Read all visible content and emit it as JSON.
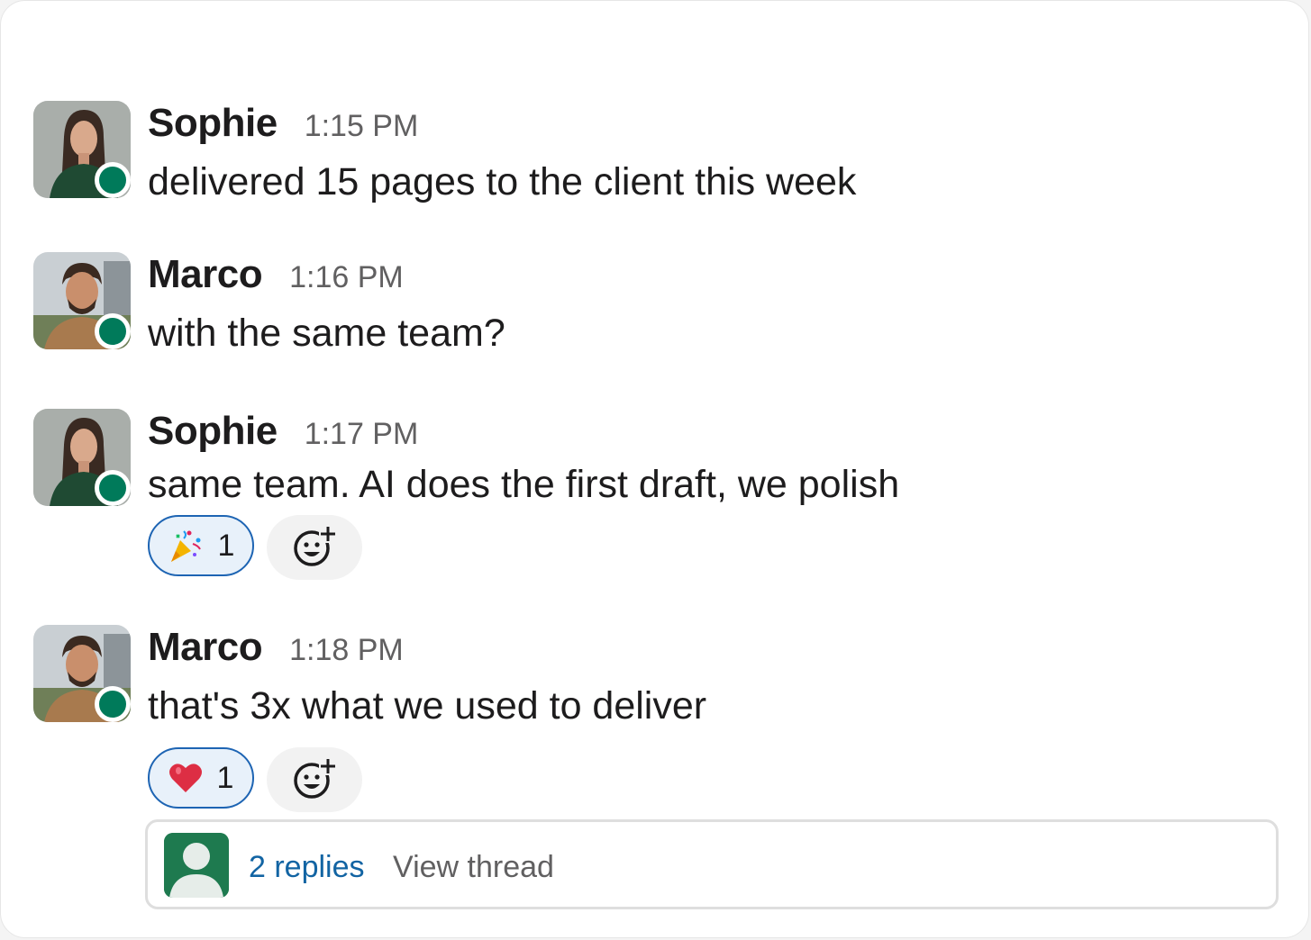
{
  "colors": {
    "presence": "#007a5a",
    "link": "#1264a3",
    "reaction_border": "#1d64b3",
    "reaction_bg": "#e8f1fa"
  },
  "messages": [
    {
      "author": "Sophie",
      "time": "1:15 PM",
      "text": "delivered 15 pages to the client this week",
      "avatar": "sophie-avatar",
      "status": "online"
    },
    {
      "author": "Marco",
      "time": "1:16 PM",
      "text": "with the same team?",
      "avatar": "marco-avatar",
      "status": "online"
    },
    {
      "author": "Sophie",
      "time": "1:17 PM",
      "text": "same team. AI does the first draft, we polish",
      "avatar": "sophie-avatar",
      "status": "online",
      "reactions": [
        {
          "emoji": "party-popper-icon",
          "count": "1"
        }
      ]
    },
    {
      "author": "Marco",
      "time": "1:18 PM",
      "text": "that's 3x what we used to deliver",
      "avatar": "marco-avatar",
      "status": "online",
      "reactions": [
        {
          "emoji": "red-heart-icon",
          "count": "1"
        }
      ]
    }
  ],
  "thread": {
    "replies_label": "2 replies",
    "view_label": "View thread",
    "avatar": "default-user-icon"
  },
  "icons": {
    "add_reaction": "add-reaction-icon"
  }
}
